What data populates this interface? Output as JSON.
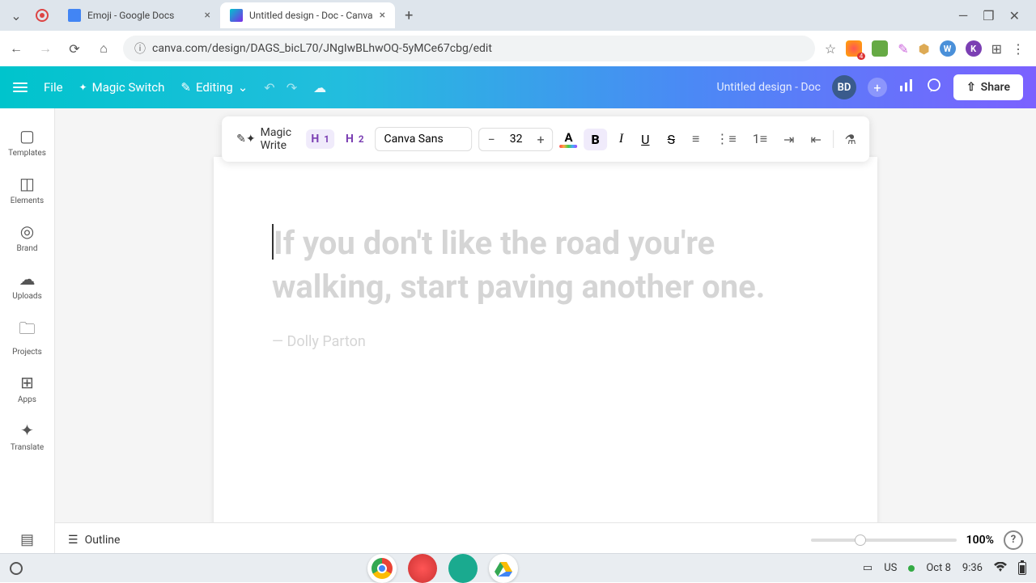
{
  "browser": {
    "tabs": [
      {
        "title": "Emoji - Google Docs"
      },
      {
        "title": "Untitled design - Doc - Canva"
      }
    ],
    "url": "canva.com/design/DAGS_bicL70/JNgIwBLhwOQ-5yMCe67cbg/edit"
  },
  "header": {
    "file": "File",
    "magic_switch": "Magic Switch",
    "editing": "Editing",
    "doc_name": "Untitled design - Doc",
    "avatar": "BD",
    "share": "Share"
  },
  "sidebar": {
    "items": [
      {
        "label": "Templates"
      },
      {
        "label": "Elements"
      },
      {
        "label": "Brand"
      },
      {
        "label": "Uploads"
      },
      {
        "label": "Projects"
      },
      {
        "label": "Apps"
      },
      {
        "label": "Translate"
      }
    ]
  },
  "toolbar": {
    "magic_write": "Magic Write",
    "h1": "H1",
    "h2": "H2",
    "font": "Canva Sans",
    "size": "32",
    "bold": "B",
    "italic": "I",
    "underline": "U",
    "strike": "S"
  },
  "document": {
    "placeholder_quote": "If you don't like the road you're walking, start paving another one.",
    "placeholder_author": "— Dolly Parton"
  },
  "bottom": {
    "outline": "Outline",
    "zoom": "100%"
  },
  "os": {
    "lang": "US",
    "date": "Oct 8",
    "time": "9:36"
  }
}
